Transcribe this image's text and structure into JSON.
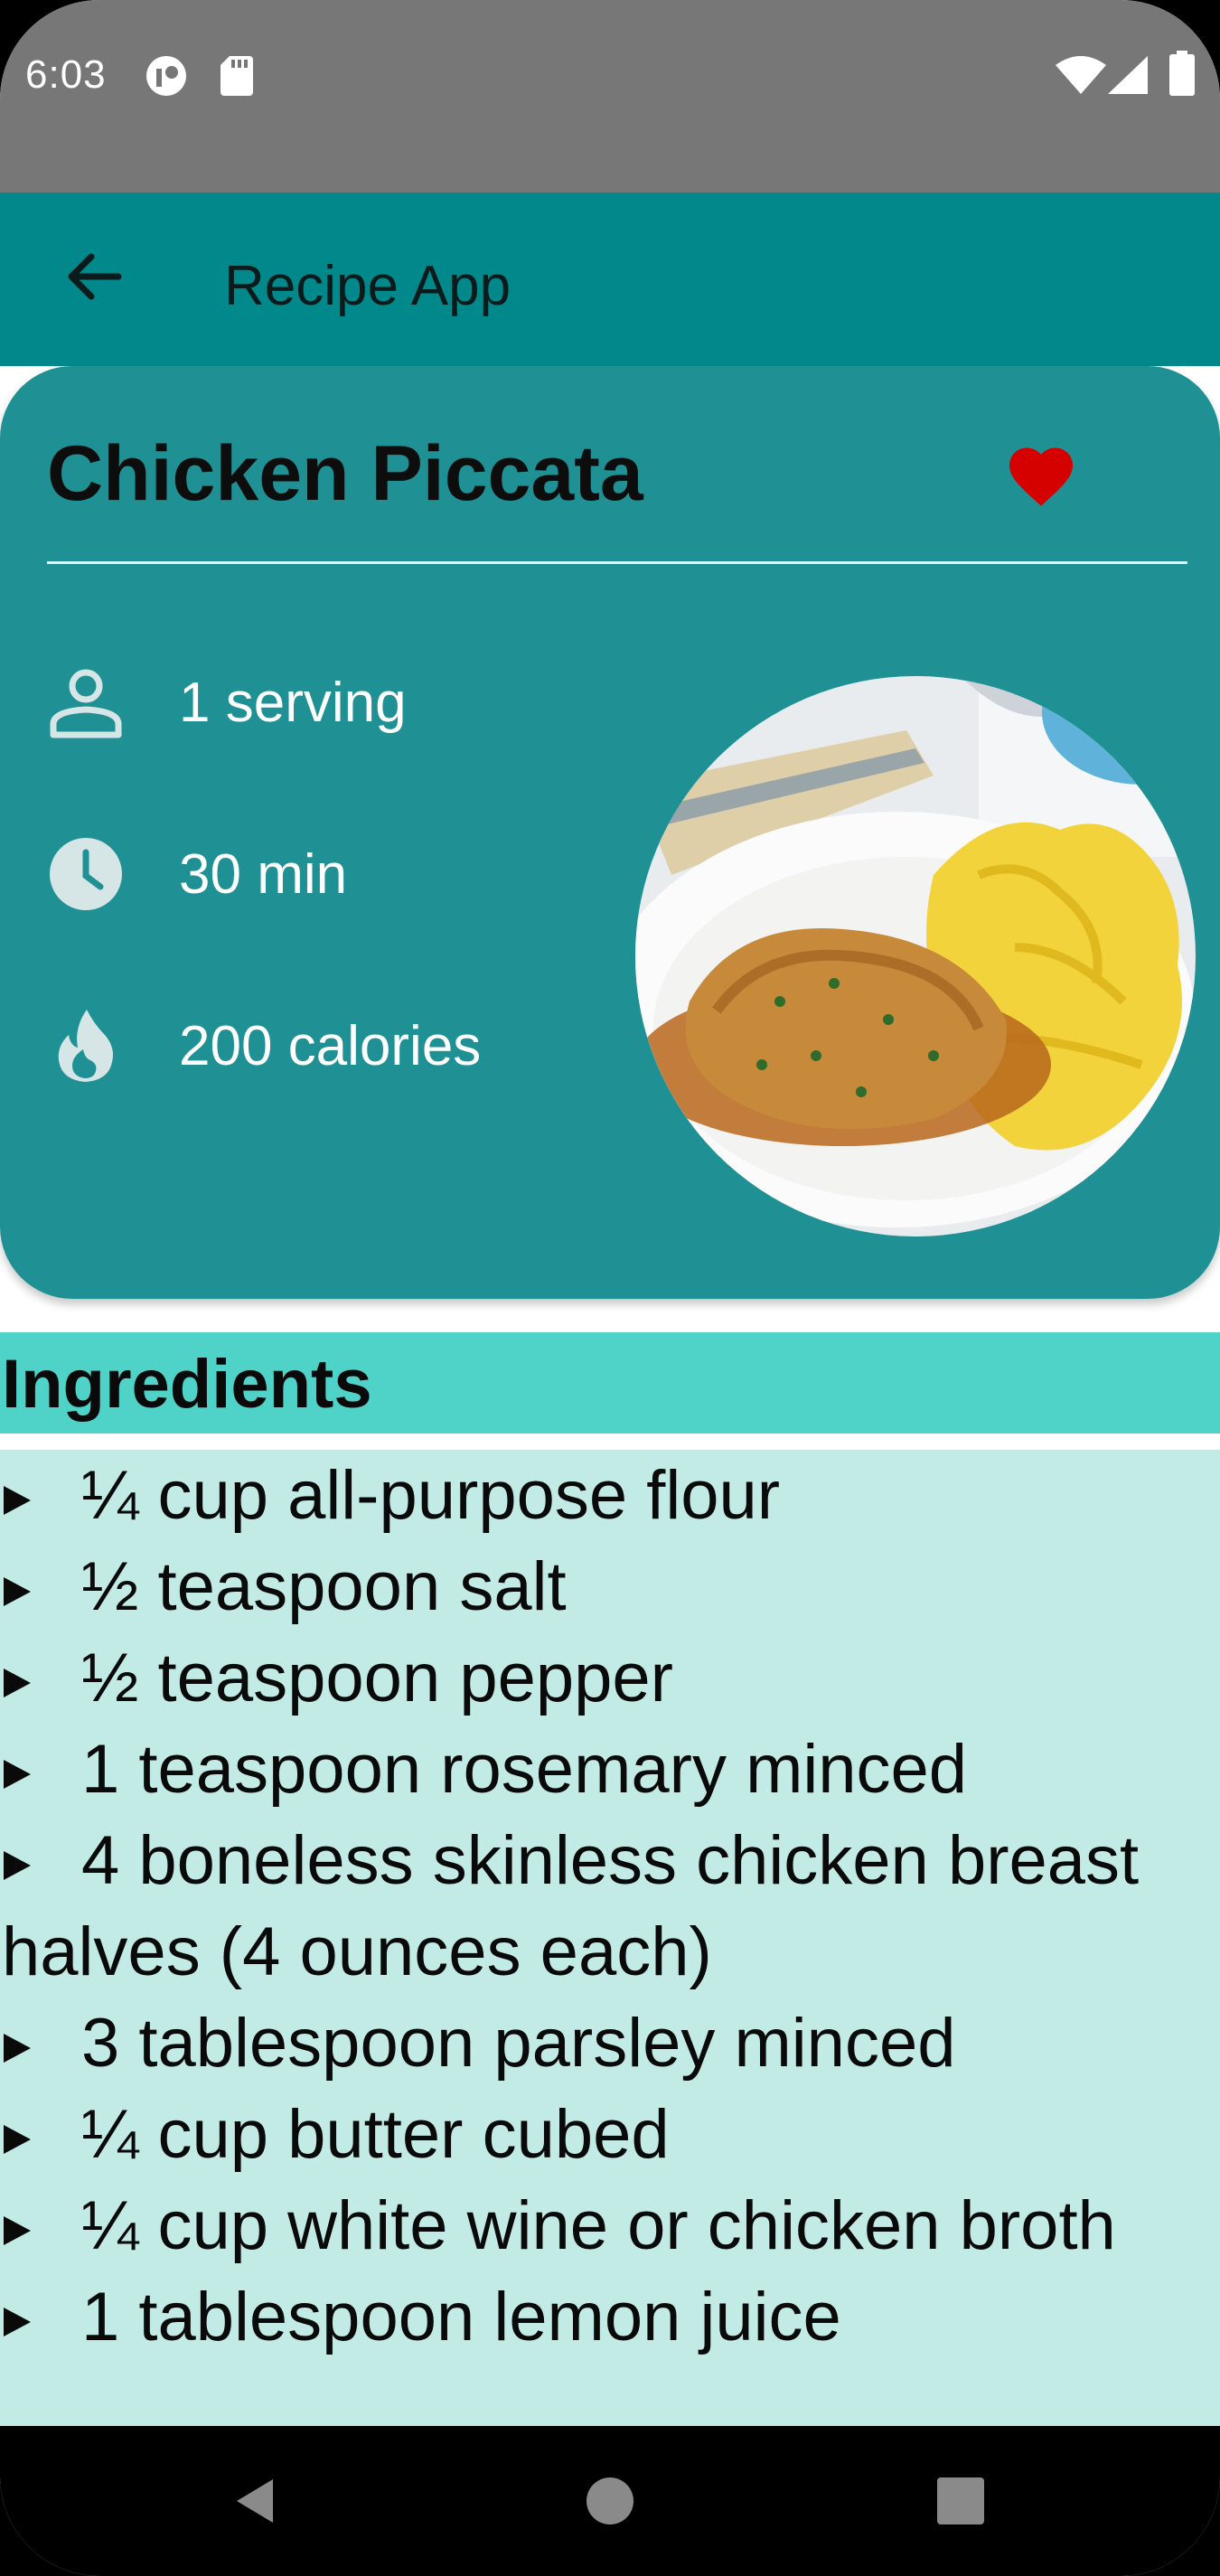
{
  "status_bar": {
    "time": "6:03",
    "icons_left": [
      "vpn-key-icon",
      "sd-card-icon"
    ],
    "icons_right": [
      "wifi-icon",
      "cell-signal-icon",
      "battery-icon"
    ]
  },
  "app_bar": {
    "title": "Recipe App",
    "back_icon": "arrow-left-icon"
  },
  "recipe": {
    "title": "Chicken Piccata",
    "favorite": true,
    "favorite_color": "#d50000",
    "servings": "1 serving",
    "time": "30 min",
    "calories": "200 calories",
    "info_icons": [
      "person-icon",
      "clock-icon",
      "flame-icon"
    ]
  },
  "ingredients": {
    "title": "Ingredients",
    "items": [
      "¼ cup all-purpose flour",
      "½ teaspoon salt",
      "½ teaspoon pepper",
      "1 teaspoon rosemary minced",
      "4 boneless skinless chicken breast halves (4 ounces each)",
      "3 tablespoon parsley minced",
      "¼ cup butter cubed",
      "¼ cup white wine or chicken broth",
      "1 tablespoon lemon juice"
    ]
  },
  "colors": {
    "status_bar": "#777777",
    "app_bar": "#00888a",
    "card": "#1f9194",
    "ingredients_header": "#4fd3c8",
    "ingredients_bg": "#c3ebe6"
  },
  "nav_bar": {
    "buttons": [
      "back-triangle-icon",
      "home-circle-icon",
      "recents-square-icon"
    ]
  }
}
